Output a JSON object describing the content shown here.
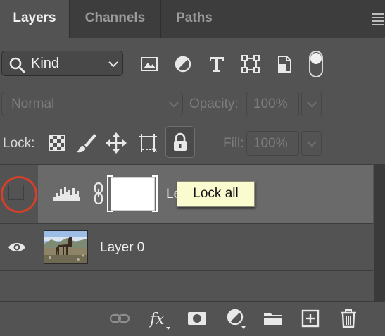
{
  "tabs": [
    {
      "label": "Layers",
      "active": true
    },
    {
      "label": "Channels",
      "active": false
    },
    {
      "label": "Paths",
      "active": false
    }
  ],
  "filter": {
    "kind_label": "Kind"
  },
  "blend_mode": {
    "label": "Normal"
  },
  "opacity": {
    "label": "Opacity:",
    "value": "100%"
  },
  "lock": {
    "label": "Lock:"
  },
  "fill": {
    "label": "Fill:",
    "value": "100%"
  },
  "layers": [
    {
      "name": "Le",
      "type": "levels-adjustment",
      "visible": false,
      "selected": true
    },
    {
      "name": "Layer 0",
      "type": "pixel",
      "visible": true,
      "selected": false
    }
  ],
  "tooltip": {
    "text": "Lock all"
  },
  "colors": {
    "panel_bg": "#535353",
    "list_bg": "#3d3d3d",
    "selected_row": "#6a6a6a",
    "highlight_ring": "#d6402a",
    "tooltip_bg": "#fbfbd0"
  }
}
